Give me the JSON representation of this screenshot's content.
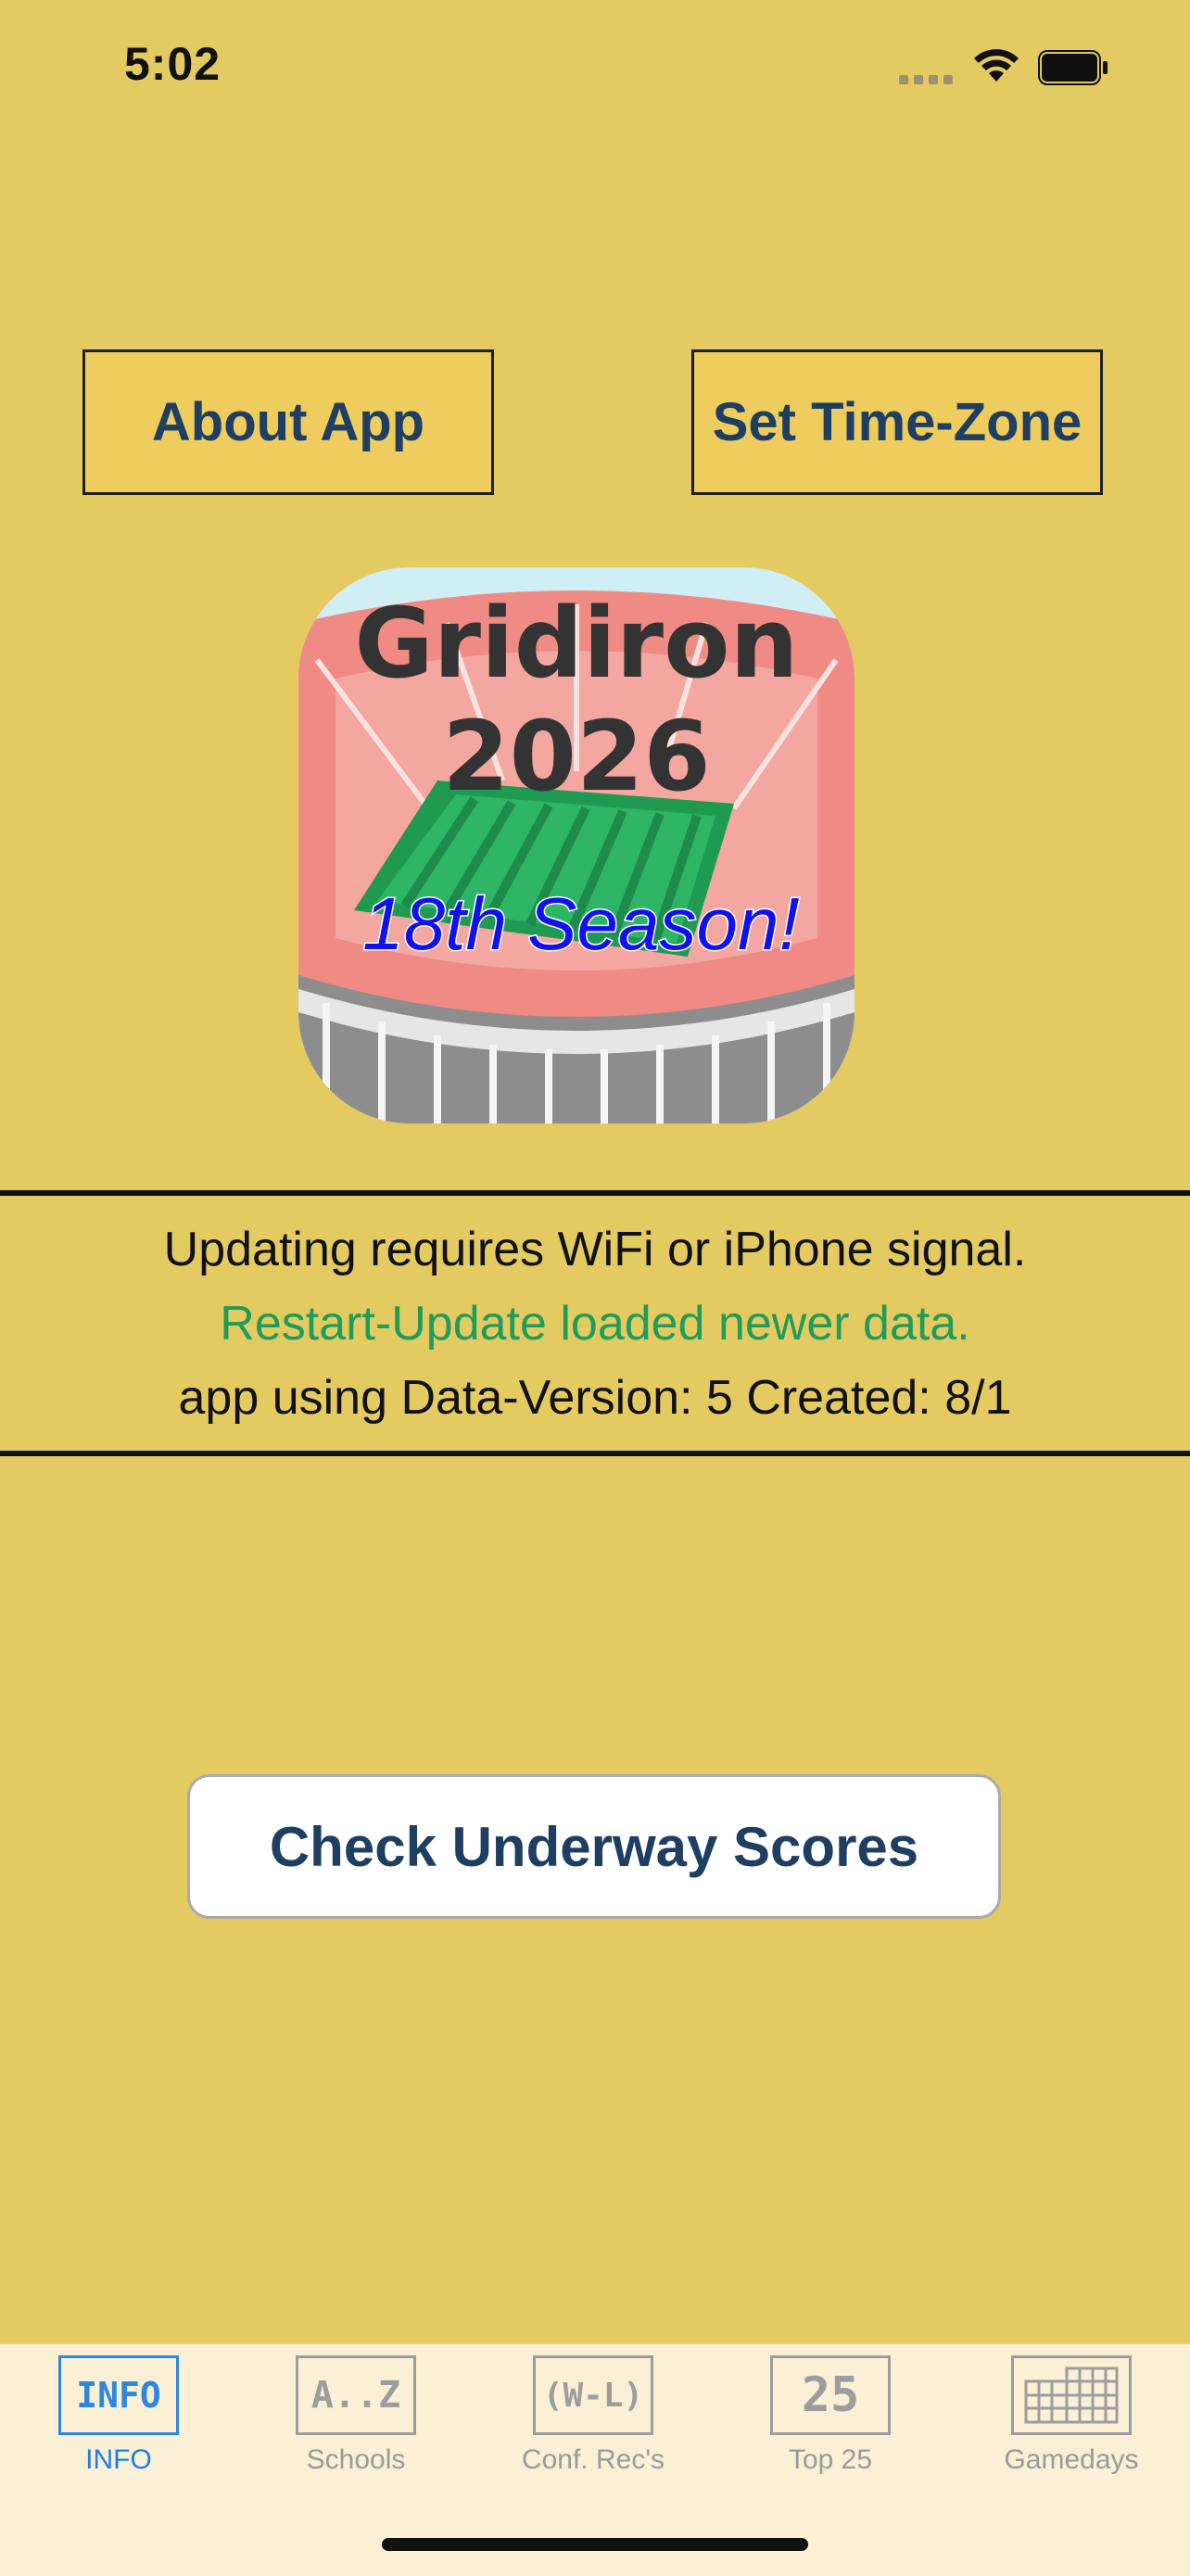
{
  "status_bar": {
    "time": "5:02"
  },
  "header": {
    "about_label": "About App",
    "timezone_label": "Set Time-Zone"
  },
  "app_icon": {
    "title_line1": "Gridiron",
    "title_line2": "2026",
    "subtitle": "18th Season!"
  },
  "info": {
    "line1": "Updating requires WiFi or iPhone signal.",
    "line2": "Restart-Update loaded newer data.",
    "line3": "app using Data-Version: 5 Created: 8/1"
  },
  "main": {
    "underway_label": "Check Underway Scores"
  },
  "tabs": [
    {
      "icon_text": "INFO",
      "label": "INFO",
      "active": true
    },
    {
      "icon_text": "A..Z",
      "label": "Schools"
    },
    {
      "icon_text": "(W-L)",
      "label": "Conf. Rec's"
    },
    {
      "icon_text": "25",
      "label": "Top 25"
    },
    {
      "icon_text": "",
      "label": "Gamedays"
    }
  ],
  "colors": {
    "background": "#E3CB62",
    "button_text": "#1E3E62",
    "info_green": "#1F9B5A",
    "tab_active": "#2D86E4"
  }
}
